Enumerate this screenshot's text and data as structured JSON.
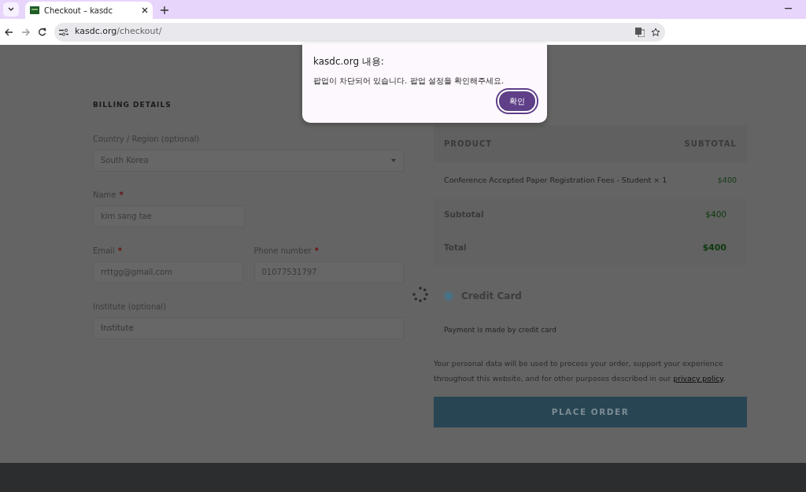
{
  "browser": {
    "tab_title": "Checkout – kasdc",
    "url_host": "kasdc.org",
    "url_path": "/checkout/"
  },
  "dialog": {
    "title": "kasdc.org 내용:",
    "message": "팝업이 차단되어 있습니다. 팝업 설정을 확인해주세요.",
    "button": "확인"
  },
  "billing": {
    "heading": "BILLING DETAILS",
    "rows": [
      [
        {
          "kind": "select",
          "label": "Country / Region (optional)",
          "value": "South Korea"
        }
      ],
      [
        {
          "kind": "text",
          "label": "Name",
          "required_mark": "*",
          "value": "kim sang tae"
        }
      ],
      [
        {
          "kind": "text",
          "label": "Email",
          "required_mark": "*",
          "value": "rrttgg@gmail.com"
        },
        {
          "kind": "text",
          "label": "Phone number",
          "required_mark": "*",
          "value": "01077531797"
        }
      ],
      [
        {
          "kind": "long-text",
          "label": "Institute (optional)",
          "placeholder": "Institute"
        }
      ]
    ]
  },
  "order": {
    "columns": [
      "PRODUCT",
      "SUBTOTAL"
    ],
    "items": [
      {
        "name": "Conference Accepted Paper Registration Fees - Student",
        "quantity": "× 1",
        "price": "$400"
      }
    ],
    "totals": [
      {
        "kind": "subtotal",
        "label": "Subtotal",
        "value": "$400"
      },
      {
        "kind": "total",
        "label": "Total",
        "value": "$400"
      }
    ]
  },
  "payment": {
    "methods": [
      {
        "label": "Credit Card",
        "selected": true
      }
    ],
    "description": "Payment is made by credit card"
  },
  "privacy": {
    "text_before": "Your personal data will be used to process your order, support your experience throughout this website, and for other purposes described in our ",
    "link": "privacy policy",
    "text_after": "."
  },
  "place_order": "PLACE ORDER"
}
